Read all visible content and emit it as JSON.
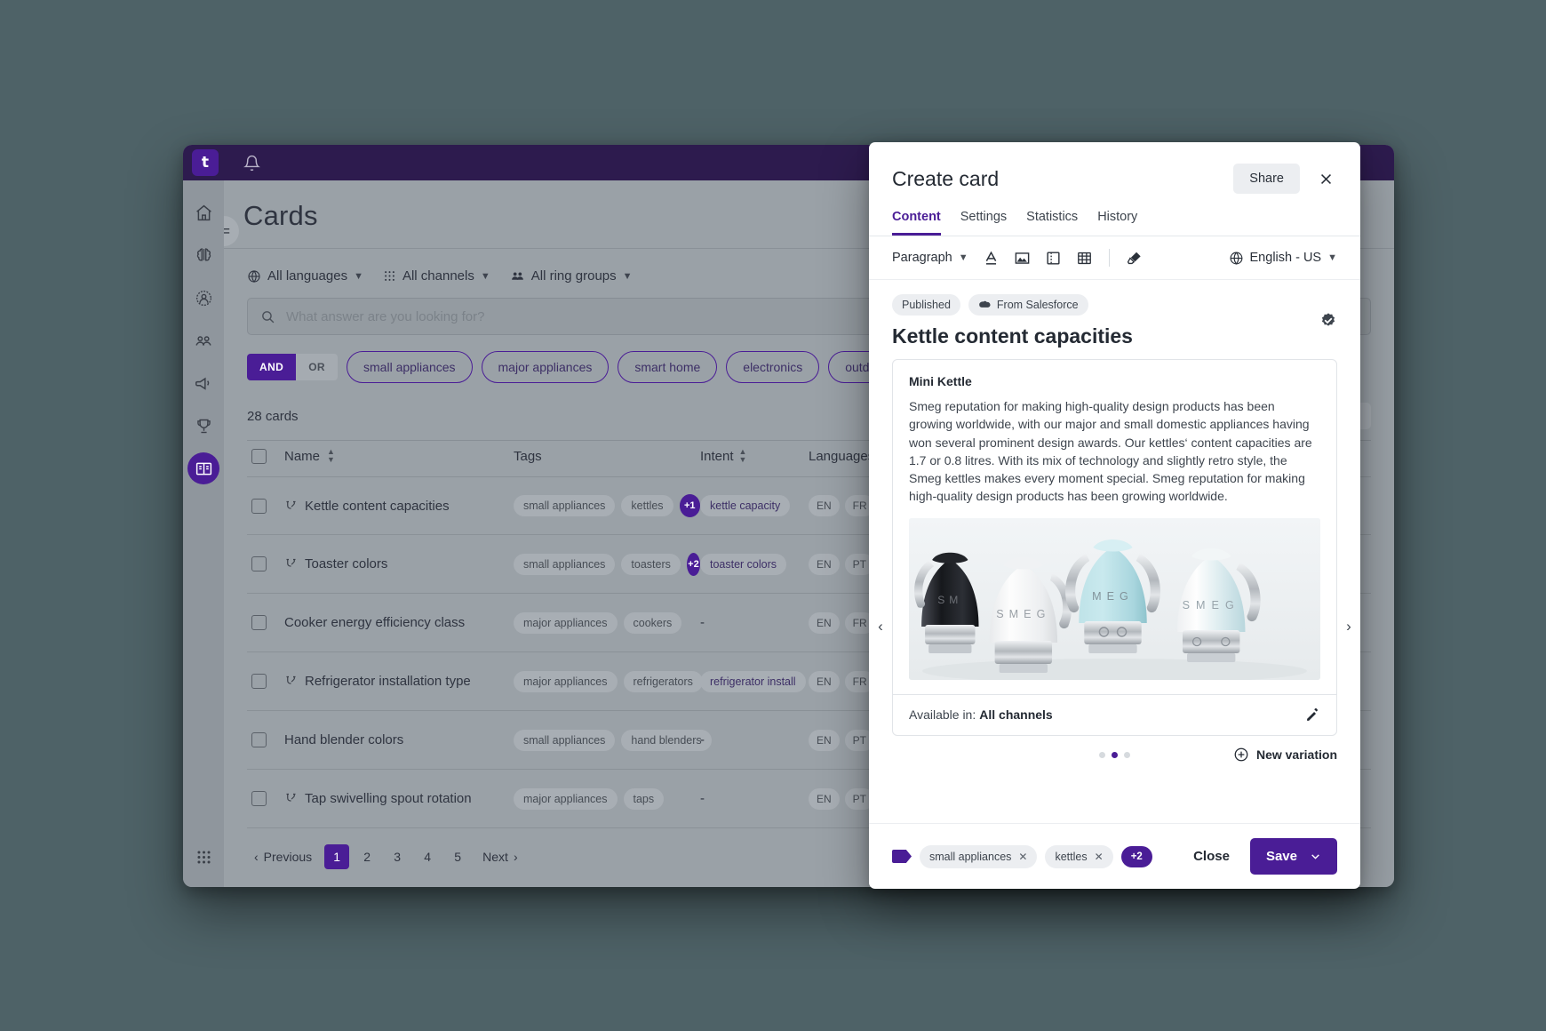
{
  "app": {
    "logo_text": "t",
    "page_title": "Cards"
  },
  "sidebar": {
    "items": [
      {
        "name": "home",
        "label": "Home"
      },
      {
        "name": "brain",
        "label": "AI"
      },
      {
        "name": "person-circle",
        "label": "Agent"
      },
      {
        "name": "group",
        "label": "Teams"
      },
      {
        "name": "megaphone",
        "label": "Campaigns"
      },
      {
        "name": "trophy",
        "label": "Gamification"
      },
      {
        "name": "book",
        "label": "Knowledge"
      }
    ],
    "bottom": {
      "name": "apps-grid",
      "label": "Apps"
    }
  },
  "filters": {
    "languages": "All languages",
    "channels": "All channels",
    "ring_groups": "All ring groups"
  },
  "search": {
    "placeholder": "What answer are you looking for?",
    "value": ""
  },
  "query_builder": {
    "and_label": "AND",
    "or_label": "OR",
    "active_operator": "AND",
    "tags": [
      "small appliances",
      "major appliances",
      "smart home",
      "electronics",
      "outdoors"
    ],
    "add_label": "+"
  },
  "list": {
    "count_label": "28 cards",
    "view_modes": [
      "list",
      "grid"
    ],
    "active_view": "list",
    "columns": [
      "Name",
      "Tags",
      "Intent",
      "Languages"
    ],
    "rows": [
      {
        "name": "Kettle content capacities",
        "has_branch": true,
        "tags": [
          "small appliances",
          "kettles"
        ],
        "tags_more": "+1",
        "intent": "kettle capacity",
        "languages": [
          "EN",
          "FR"
        ],
        "languages_more": "+"
      },
      {
        "name": "Toaster colors",
        "has_branch": true,
        "tags": [
          "small appliances",
          "toasters"
        ],
        "tags_more": "+2",
        "intent": "toaster colors",
        "languages": [
          "EN",
          "PT"
        ],
        "languages_more": ""
      },
      {
        "name": "Cooker energy efficiency class",
        "has_branch": false,
        "tags": [
          "major appliances",
          "cookers"
        ],
        "tags_more": "",
        "intent": "-",
        "languages": [
          "EN",
          "FR"
        ],
        "languages_more": ""
      },
      {
        "name": "Refrigerator installation type",
        "has_branch": true,
        "tags": [
          "major appliances",
          "refrigerators"
        ],
        "tags_more": "",
        "intent": "refrigerator install",
        "languages": [
          "EN",
          "FR"
        ],
        "languages_more": ""
      },
      {
        "name": "Hand blender colors",
        "has_branch": false,
        "tags": [
          "small appliances",
          "hand blenders"
        ],
        "tags_more": "",
        "intent": "-",
        "languages": [
          "EN",
          "PT"
        ],
        "languages_more": ""
      },
      {
        "name": "Tap swivelling spout rotation",
        "has_branch": true,
        "tags": [
          "major appliances",
          "taps"
        ],
        "tags_more": "",
        "intent": "-",
        "languages": [
          "EN",
          "PT"
        ],
        "languages_more": ""
      }
    ]
  },
  "pagination": {
    "previous_label": "Previous",
    "next_label": "Next",
    "pages": [
      "1",
      "2",
      "3",
      "4",
      "5"
    ],
    "current": "1"
  },
  "modal": {
    "title": "Create card",
    "share_label": "Share",
    "close_icon_label": "×",
    "tabs": [
      {
        "label": "Content",
        "active": true
      },
      {
        "label": "Settings",
        "active": false
      },
      {
        "label": "Statistics",
        "active": false
      },
      {
        "label": "History",
        "active": false
      }
    ],
    "toolbar": {
      "paragraph_label": "Paragraph",
      "icons": [
        "text-color-icon",
        "image-icon",
        "video-icon",
        "table-icon",
        "highlighter-icon"
      ],
      "language": "English - US"
    },
    "badges": [
      {
        "label": "Published",
        "icon": ""
      },
      {
        "label": "From Salesforce",
        "icon": "salesforce-cloud-icon"
      }
    ],
    "card_title": "Kettle content capacities",
    "verified_icon": "verified-badge-icon",
    "variation": {
      "subtitle": "Mini Kettle",
      "body": "Smeg reputation for making high-quality design products has been growing worldwide, with our major and small domestic appliances having won several prominent design awards. Our kettles‘ content capacities are 1.7 or 0.8 litres. With its mix of technology and slightly retro style, the Smeg kettles makes every moment special. Smeg reputation for making high-quality design products has been growing worldwide.",
      "image_alt": "Four Smeg retro electric kettles in black, white, pastel blue and white",
      "available_label": "Available in:",
      "available_value": "All channels"
    },
    "carousel": {
      "prev": "‹",
      "next": "›",
      "dots": 3,
      "active_dot": 1
    },
    "new_variation_label": "New variation",
    "footer": {
      "tags": [
        "small appliances",
        "kettles"
      ],
      "tags_more": "+2",
      "close_label": "Close",
      "save_label": "Save"
    }
  },
  "colors": {
    "purple": "#4a1d96",
    "topbar": "#2d1b4e",
    "page_bg": "#4e6267"
  }
}
